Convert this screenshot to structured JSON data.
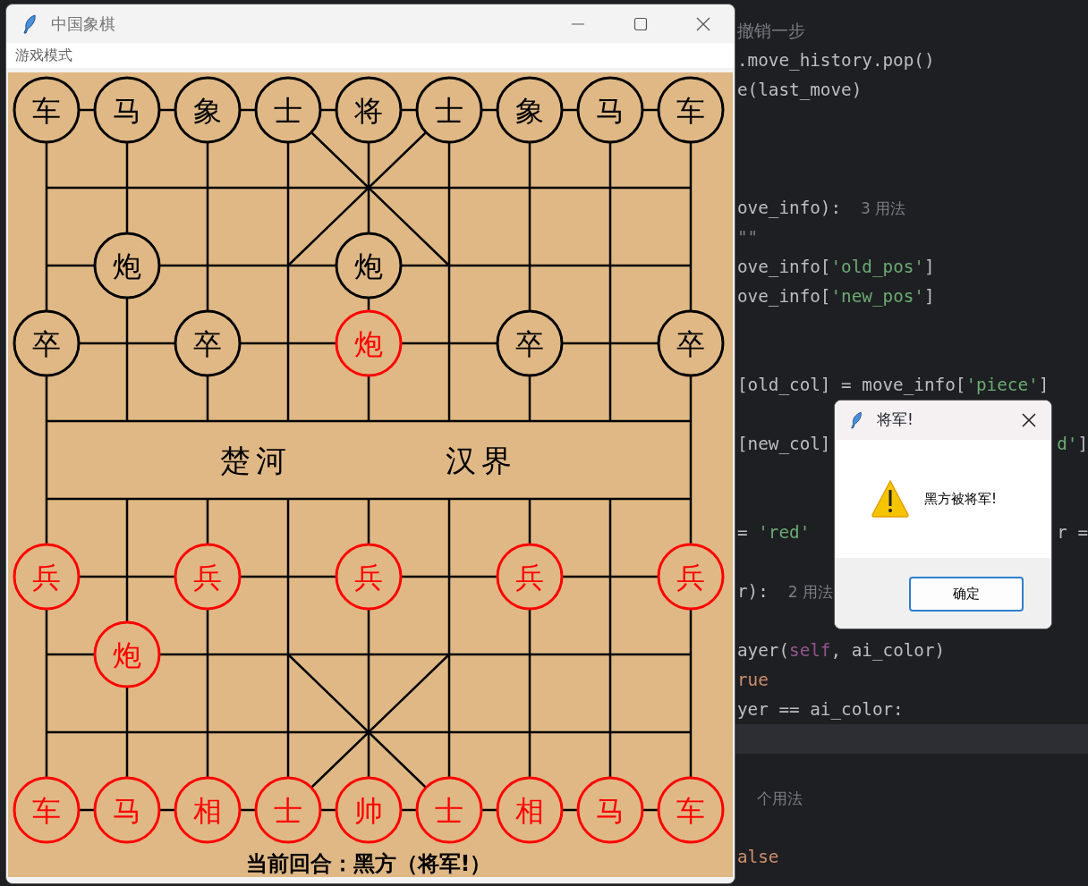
{
  "window": {
    "title": "中国象棋"
  },
  "menu": [
    {
      "label": "游戏模式"
    }
  ],
  "board": {
    "rows": [
      [
        {
          "text": "车",
          "red": false
        },
        {
          "text": "马",
          "red": false
        },
        {
          "text": "象",
          "red": false
        },
        {
          "text": "士",
          "red": false
        },
        {
          "text": "将",
          "red": false
        },
        {
          "text": "士",
          "red": false
        },
        {
          "text": "象",
          "red": false
        },
        {
          "text": "马",
          "red": false
        },
        {
          "text": "车",
          "red": false
        }
      ],
      [
        null,
        null,
        null,
        null,
        null,
        null,
        null,
        null,
        null
      ],
      [
        null,
        {
          "text": "炮",
          "red": false
        },
        null,
        null,
        {
          "text": "炮",
          "red": false
        },
        null,
        null,
        null,
        null
      ],
      [
        {
          "text": "卒",
          "red": false
        },
        null,
        {
          "text": "卒",
          "red": false
        },
        null,
        {
          "text": "炮",
          "red": true
        },
        null,
        {
          "text": "卒",
          "red": false
        },
        null,
        {
          "text": "卒",
          "red": false
        }
      ],
      [
        null,
        null,
        null,
        null,
        null,
        null,
        null,
        null,
        null
      ],
      [
        null,
        null,
        null,
        null,
        null,
        null,
        null,
        null,
        null
      ],
      [
        {
          "text": "兵",
          "red": true
        },
        null,
        {
          "text": "兵",
          "red": true
        },
        null,
        {
          "text": "兵",
          "red": true
        },
        null,
        {
          "text": "兵",
          "red": true
        },
        null,
        {
          "text": "兵",
          "red": true
        }
      ],
      [
        null,
        {
          "text": "炮",
          "red": true
        },
        null,
        null,
        null,
        null,
        null,
        null,
        null
      ],
      [
        null,
        null,
        null,
        null,
        null,
        null,
        null,
        null,
        null
      ],
      [
        {
          "text": "车",
          "red": true
        },
        {
          "text": "马",
          "red": true
        },
        {
          "text": "相",
          "red": true
        },
        {
          "text": "士",
          "red": true
        },
        {
          "text": "帅",
          "red": true
        },
        {
          "text": "士",
          "red": true
        },
        {
          "text": "相",
          "red": true
        },
        {
          "text": "马",
          "red": true
        },
        {
          "text": "车",
          "red": true
        }
      ]
    ],
    "river": [
      "楚河",
      "汉界"
    ]
  },
  "status": "当前回合：黑方（将军!）",
  "dialog": {
    "title": "将军!",
    "message": "黑方被将军!",
    "button": "确定"
  },
  "editor": {
    "lines": [
      {
        "kind": "code",
        "segments": [
          {
            "text": "撤销一步",
            "kind": "comment"
          }
        ]
      },
      {
        "kind": "code",
        "segments": [
          {
            "text": ".move_history.pop()",
            "kind": "plain"
          }
        ]
      },
      {
        "kind": "code",
        "segments": [
          {
            "text": "e(last_move)",
            "kind": "plain"
          }
        ]
      },
      {
        "kind": "blank"
      },
      {
        "kind": "blank"
      },
      {
        "kind": "blank"
      },
      {
        "kind": "code",
        "segments": [
          {
            "text": "ove_info):",
            "kind": "plain"
          },
          {
            "text": "3 用法",
            "kind": "hint"
          }
        ]
      },
      {
        "kind": "code",
        "segments": [
          {
            "text": "\"\"",
            "kind": "comment"
          }
        ]
      },
      {
        "kind": "code",
        "segments": [
          {
            "text": "ove_info[",
            "kind": "plain"
          },
          {
            "text": "'old_pos'",
            "kind": "string"
          },
          {
            "text": "]",
            "kind": "plain"
          }
        ]
      },
      {
        "kind": "code",
        "segments": [
          {
            "text": "ove_info[",
            "kind": "plain"
          },
          {
            "text": "'new_pos'",
            "kind": "string"
          },
          {
            "text": "]",
            "kind": "plain"
          }
        ]
      },
      {
        "kind": "blank"
      },
      {
        "kind": "blank"
      },
      {
        "kind": "code",
        "segments": [
          {
            "text": "[old_col] = move_info[",
            "kind": "plain"
          },
          {
            "text": "'piece'",
            "kind": "string"
          },
          {
            "text": "]",
            "kind": "plain"
          }
        ]
      },
      {
        "kind": "blank"
      },
      {
        "kind": "code",
        "segments": [
          {
            "text": "[new_col]",
            "kind": "plain"
          }
        ],
        "tail": [
          {
            "text": "d'",
            "kind": "string"
          },
          {
            "text": "]",
            "kind": "plain"
          }
        ]
      },
      {
        "kind": "blank"
      },
      {
        "kind": "blank"
      },
      {
        "kind": "code",
        "segments": [
          {
            "text": "= ",
            "kind": "plain"
          },
          {
            "text": "'red'",
            "kind": "string"
          }
        ],
        "tail": [
          {
            "text": "r =",
            "kind": "plain"
          }
        ]
      },
      {
        "kind": "blank"
      },
      {
        "kind": "code",
        "segments": [
          {
            "text": "r):",
            "kind": "plain"
          },
          {
            "text": "2 用法",
            "kind": "hint"
          }
        ]
      },
      {
        "kind": "blank"
      },
      {
        "kind": "code",
        "segments": [
          {
            "text": "ayer(",
            "kind": "plain"
          },
          {
            "text": "self",
            "kind": "keyword"
          },
          {
            "text": ", ai_color)",
            "kind": "plain"
          }
        ]
      },
      {
        "kind": "code",
        "segments": [
          {
            "text": "rue",
            "kind": "constant"
          }
        ]
      },
      {
        "kind": "code",
        "segments": [
          {
            "text": "yer == ai_color:",
            "kind": "plain"
          }
        ]
      },
      {
        "kind": "blank",
        "current": true
      },
      {
        "kind": "blank"
      },
      {
        "kind": "code",
        "segments": [
          {
            "text": "个用法",
            "kind": "hint"
          }
        ]
      },
      {
        "kind": "blank"
      },
      {
        "kind": "code",
        "segments": [
          {
            "text": "alse",
            "kind": "constant"
          }
        ]
      }
    ]
  }
}
